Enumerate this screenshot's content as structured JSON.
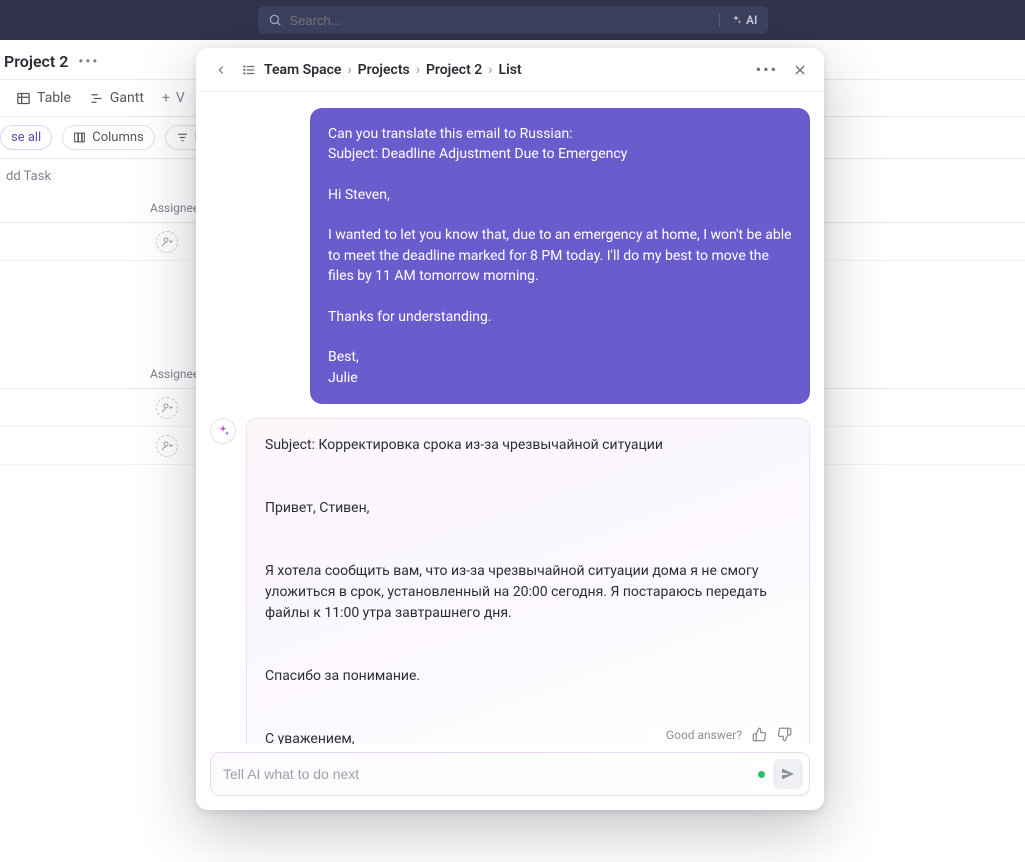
{
  "topbar": {
    "search_placeholder": "Search...",
    "ai_label": "AI"
  },
  "page": {
    "title": "Project 2",
    "tabs": {
      "table": "Table",
      "gantt": "Gantt",
      "add_view": "V"
    },
    "toolbar": {
      "collapse": "se all",
      "columns": "Columns",
      "filters": "Filters"
    },
    "add_task": "dd Task",
    "column_assignee": "Assignee"
  },
  "modal": {
    "crumbs": [
      "Team Space",
      "Projects",
      "Project 2",
      "List"
    ],
    "user_message": "Can you translate this email to Russian:\nSubject: Deadline Adjustment Due to Emergency\n\nHi Steven,\n\nI wanted to let you know that, due to an emergency at home, I won't be able to meet the deadline marked for 8 PM today. I'll do my best to move the files by 11 AM tomorrow morning.\n\nThanks for understanding.\n\nBest,\nJulie",
    "ai_message": "Subject: Корректировка срока из-за чрезвычайной ситуации\n\n\nПривет, Стивен,\n\n\nЯ хотела сообщить вам, что из-за чрезвычайной ситуации дома я не смогу уложиться в срок, установленный на 20:00 сегодня. Я постараюсь передать файлы к 11:00 утра завтрашнего дня.\n\n\nСпасибо за понимание.\n\n\nС уважением,\nДжули",
    "feedback_label": "Good answer?",
    "composer_placeholder": "Tell AI what to do next"
  }
}
